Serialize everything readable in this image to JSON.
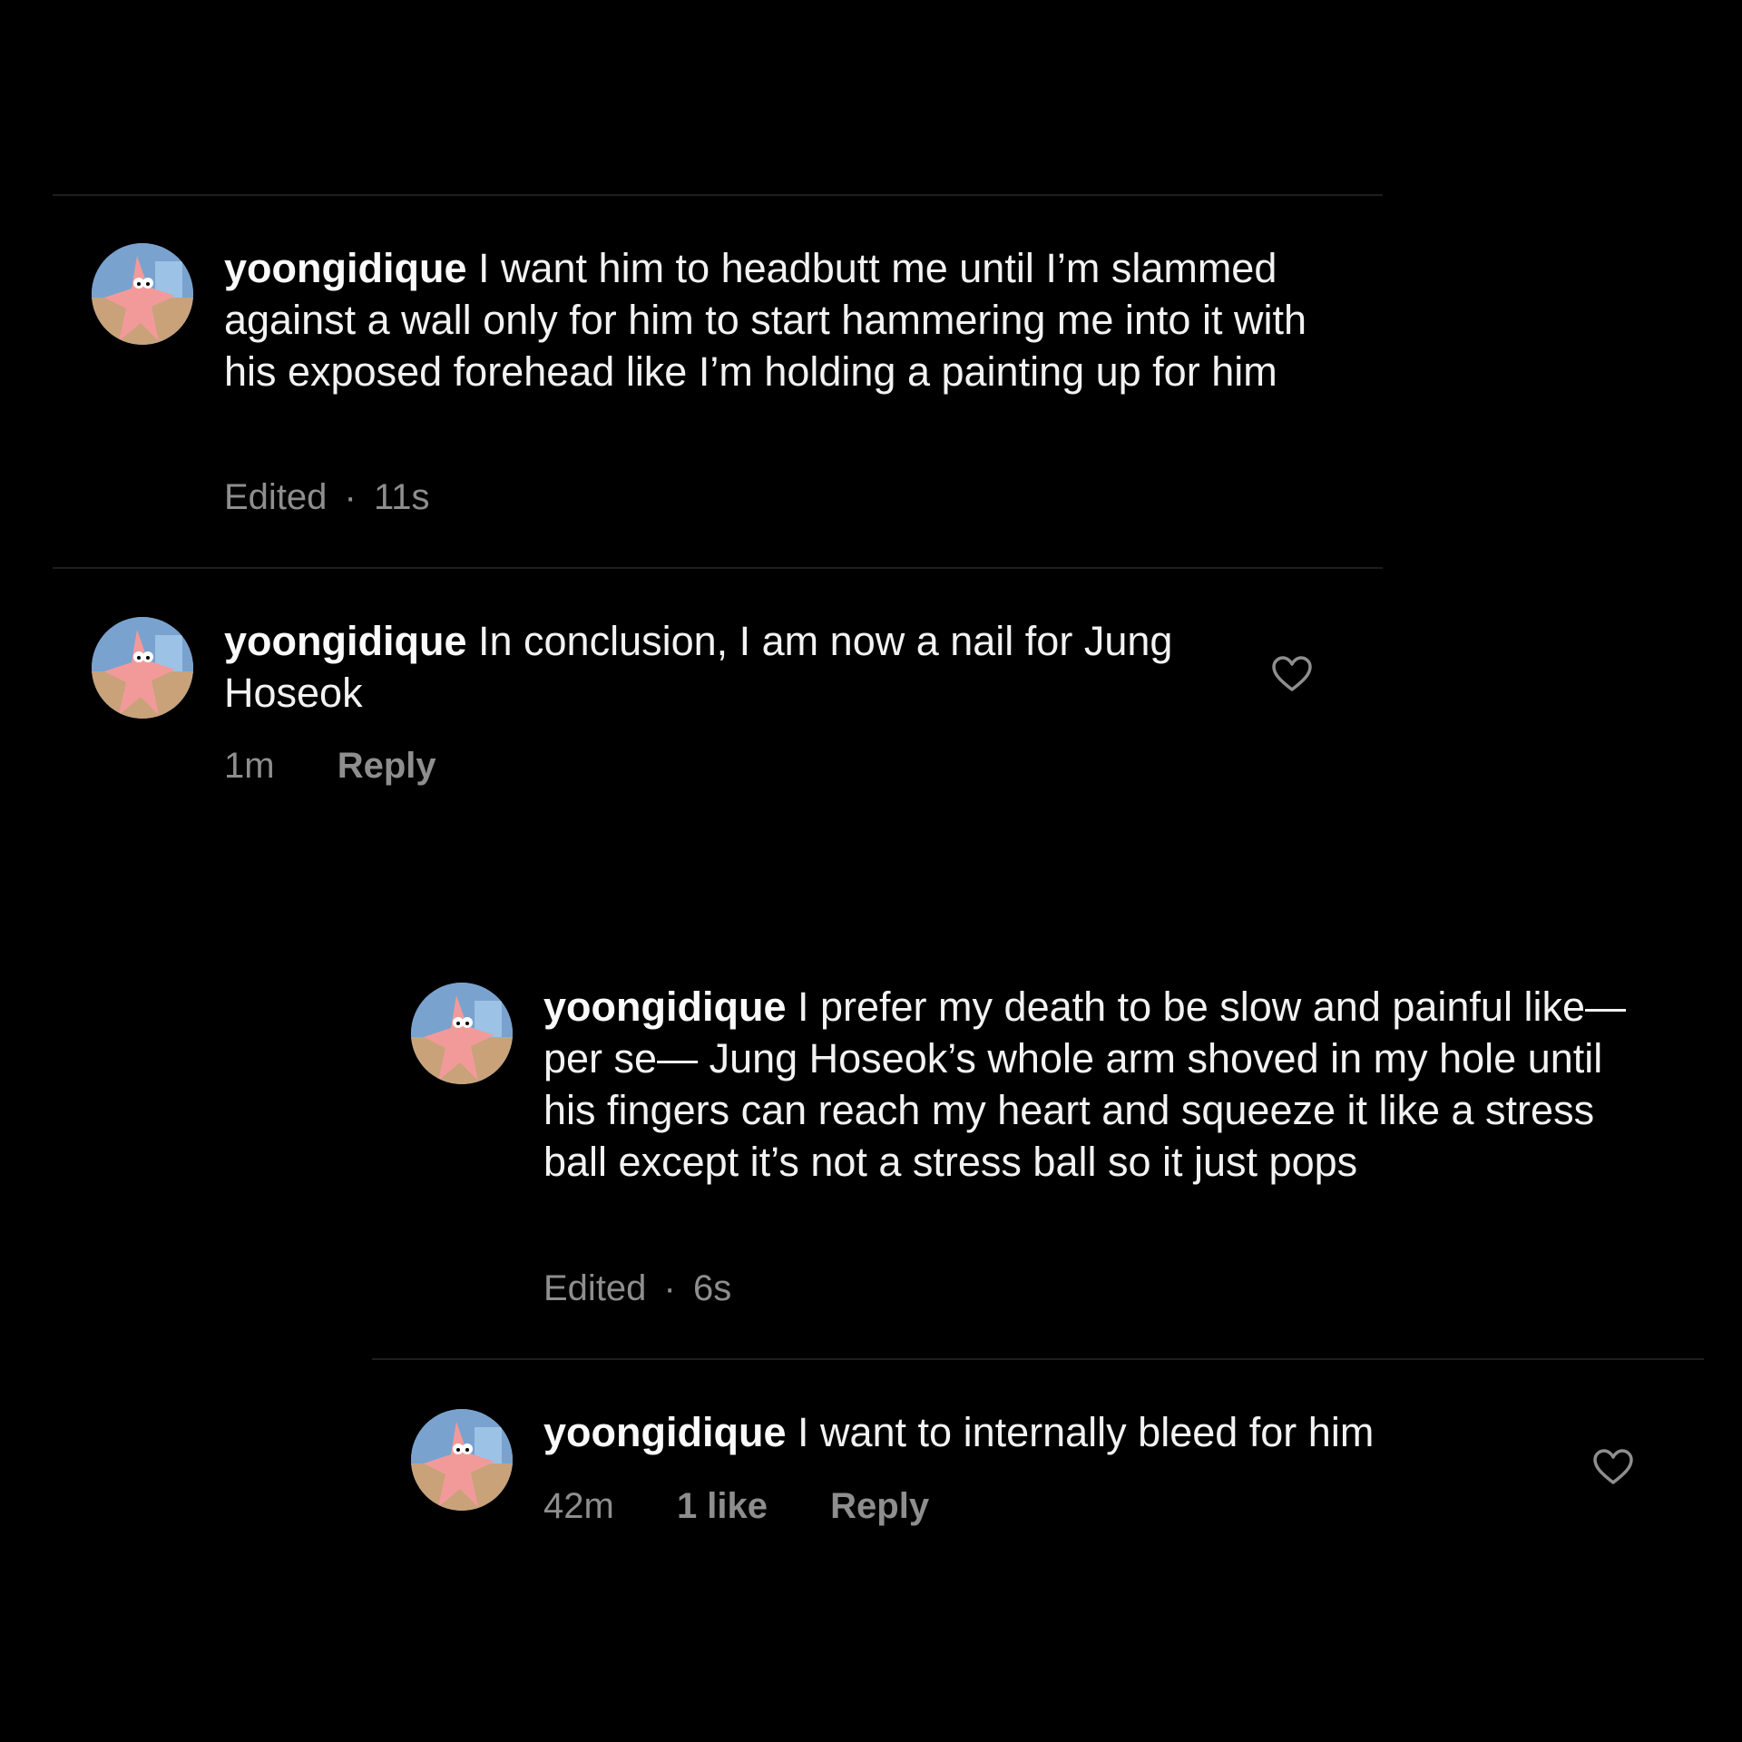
{
  "comments": [
    {
      "username": "yoongidique",
      "text": " I want him to headbutt me until I’m slammed against a wall only for him to start hammering me into it with his exposed forehead like I’m holding a painting up for him",
      "edited": "Edited",
      "separator": "·",
      "time": "11s"
    },
    {
      "username": "yoongidique",
      "text": " In conclusion, I am now a nail for Jung Hoseok",
      "time": "1m",
      "reply": "Reply"
    },
    {
      "username": "yoongidique",
      "text": " I prefer my death to be slow and painful like— per se— Jung Hoseok’s whole arm shoved in my hole until his fingers can reach my heart and squeeze it like a stress ball except it’s not a stress ball so it just pops",
      "edited": "Edited",
      "separator": "·",
      "time": "6s"
    },
    {
      "username": "yoongidique",
      "text": " I want to internally bleed for him",
      "time": "42m",
      "likes": "1 like",
      "reply": "Reply"
    }
  ],
  "icons": {
    "avatar": "patrick-star-avatar",
    "like": "heart-outline-icon"
  },
  "colors": {
    "background": "#000000",
    "text": "#f2f2f2",
    "meta": "#8e8e8e",
    "divider": "#1e1e1e"
  }
}
